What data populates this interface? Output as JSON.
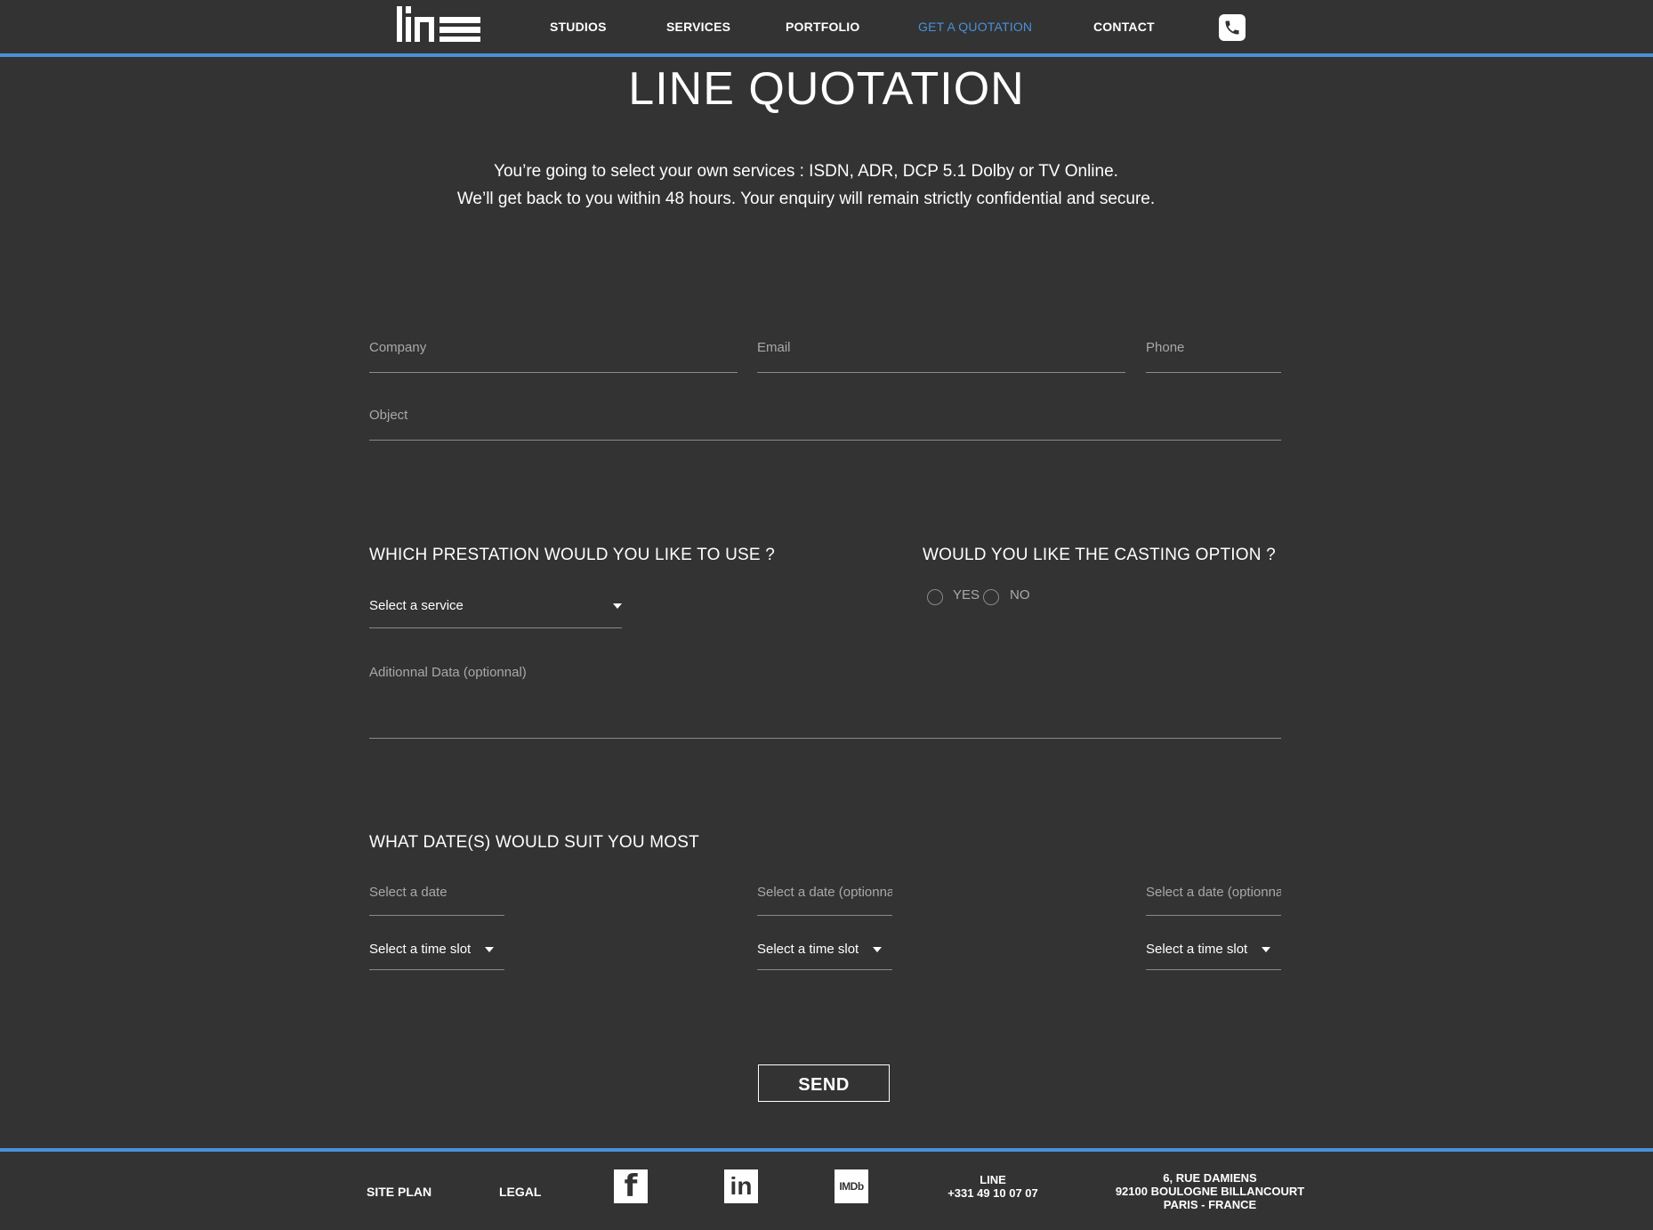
{
  "nav": {
    "logo_alt": "line",
    "items": [
      {
        "label": "STUDIOS"
      },
      {
        "label": "SERVICES"
      },
      {
        "label": "PORTFOLIO"
      },
      {
        "label": "GET A QUOTATION"
      },
      {
        "label": "CONTACT"
      }
    ],
    "active_index": 3
  },
  "page": {
    "title": "LINE QUOTATION",
    "intro_line1": "You’re going to select your own services  : ISDN, ADR, DCP 5.1 Dolby or TV Online.",
    "intro_line2": "We’ll get back to you within 48 hours. Your enquiry will remain strictly confidential and secure."
  },
  "form": {
    "company_placeholder": "Company",
    "email_placeholder": "Email",
    "phone_placeholder": "Phone",
    "object_placeholder": "Object",
    "prestation_title": "WHICH PRESTATION WOULD YOU LIKE TO USE ?",
    "service_select": "Select a service",
    "casting_title": "WOULD YOU LIKE THE CASTING OPTION ?",
    "casting_yes": "YES",
    "casting_no": "NO",
    "additional_placeholder": "Aditionnal Data (optionnal)",
    "dates_title": "WHAT DATE(S) WOULD SUIT YOU MOST",
    "date1_placeholder": "Select a date",
    "date2_placeholder": "Select a date (optionnal)",
    "date3_placeholder": "Select a date (optionnal)",
    "timeslot1": "Select a time slot",
    "timeslot2": "Select a time slot",
    "timeslot3": "Select a time slot",
    "send_label": "SEND"
  },
  "footer": {
    "site_plan": "SITE PLAN",
    "legal": "LEGAL",
    "facebook_glyph": "f",
    "linkedin_glyph": "in",
    "imdb_glyph": "IMDb",
    "company_name": "LINE",
    "company_phone": "+331 49 10 07 07",
    "address_line1": "6, RUE DAMIENS",
    "address_line2": "92100 BOULOGNE BILLANCOURT",
    "address_line3": "PARIS - FRANCE"
  },
  "colors": {
    "background": "#333333",
    "accent": "#4a90d9",
    "text": "#ffffff",
    "muted": "#a8a8a8"
  }
}
